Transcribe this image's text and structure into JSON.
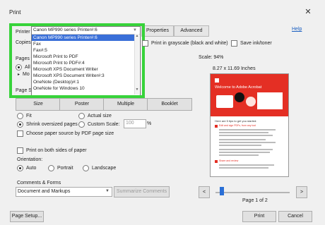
{
  "window": {
    "title": "Print",
    "close_glyph": "✕"
  },
  "help": {
    "label": "Help"
  },
  "tabs": [
    {
      "label": "Properties"
    },
    {
      "label": "Advanced"
    }
  ],
  "printer": {
    "label": "Printer",
    "selected": "Canon MP990 series Printer#:6"
  },
  "copies": {
    "label": "Copies"
  },
  "pages": {
    "label": "Pages t",
    "all": "All",
    "more": "Mo"
  },
  "page_sizing": {
    "label": "Page Si"
  },
  "dropdown": {
    "options": [
      {
        "label": "Canon MP990 series Printer#:6",
        "highlighted": true
      },
      {
        "label": "Fax"
      },
      {
        "label": "Fax#:5"
      },
      {
        "label": "Microsoft Print to PDF"
      },
      {
        "label": "Microsoft Print to PDF#:4"
      },
      {
        "label": "Microsoft XPS Document Writer"
      },
      {
        "label": "Microsoft XPS Document Writer#:3"
      },
      {
        "label": "OneNote (Desktop)#:1"
      },
      {
        "label": "OneNote for Windows 10"
      }
    ]
  },
  "options": {
    "grayscale": "Print in grayscale (black and white)",
    "save_ink": "Save ink/toner"
  },
  "sizing_buttons": [
    {
      "label": "Size"
    },
    {
      "label": "Poster"
    },
    {
      "label": "Multiple"
    },
    {
      "label": "Booklet"
    }
  ],
  "sizing": {
    "fit": "Fit",
    "actual": "Actual size",
    "shrink": "Shrink oversized pages",
    "custom": "Custom Scale:",
    "custom_value": "100",
    "percent": "%"
  },
  "paper_source": "Choose paper source by PDF page size",
  "both_sides": "Print on both sides of paper",
  "orientation": {
    "label": "Orientation:",
    "auto": "Auto",
    "portrait": "Portrait",
    "landscape": "Landscape"
  },
  "comments": {
    "label": "Comments & Forms",
    "value": "Document and Markups",
    "summarize": "Summarize Comments"
  },
  "preview": {
    "scale": "Scale:  94%",
    "size": "8.27 x 11.69 Inches",
    "page_of": "Page 1 of 2",
    "progress": 0.0
  },
  "doc": {
    "heading": "Welcome to Adobe Acrobat",
    "subheading": "Here are 5 tips to get you started:",
    "tip1": "Edit and sign PDFs, from any tool",
    "tip2": "Share and review"
  },
  "footer": {
    "page_setup": "Page Setup...",
    "print": "Print",
    "cancel": "Cancel"
  },
  "nav": {
    "prev": "<",
    "next": ">",
    "caret": "▼"
  },
  "colors": {
    "highlight": "#37d33a",
    "accent": "#2a6fd6",
    "adobe_red": "#e42f24"
  }
}
